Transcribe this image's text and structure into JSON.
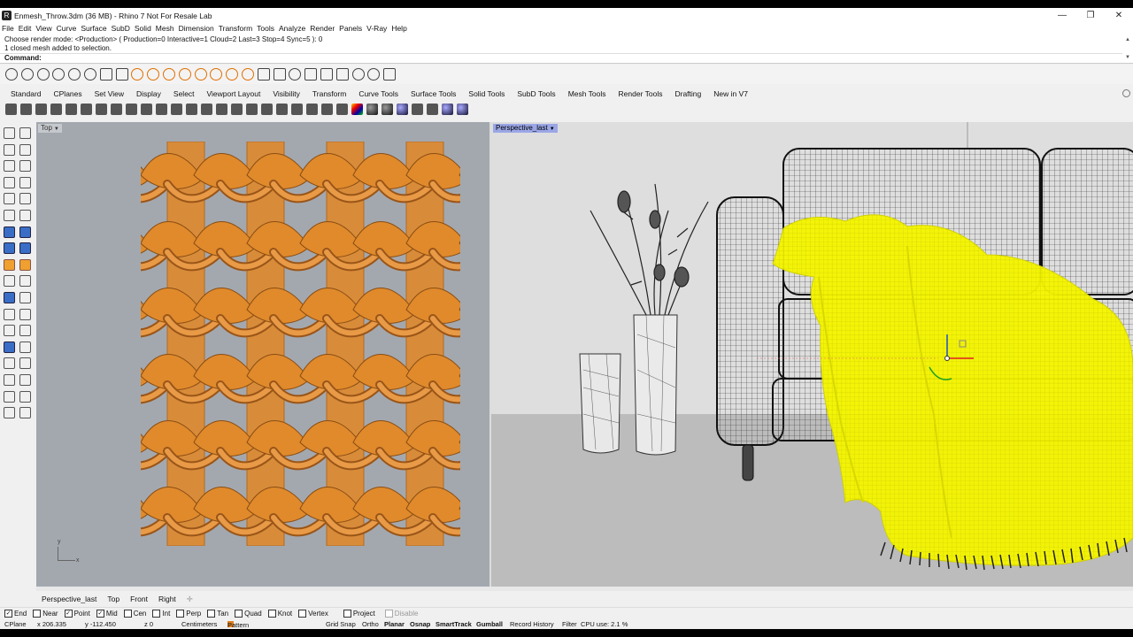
{
  "window": {
    "title": "Enmesh_Throw.3dm (36 MB) - Rhino 7 Not For Resale Lab",
    "app_icon": "rhino-icon"
  },
  "window_controls": {
    "minimize": "—",
    "maximize": "❐",
    "close": "✕"
  },
  "menu": [
    "File",
    "Edit",
    "View",
    "Curve",
    "Surface",
    "SubD",
    "Solid",
    "Mesh",
    "Dimension",
    "Transform",
    "Tools",
    "Analyze",
    "Render",
    "Panels",
    "V-Ray",
    "Help"
  ],
  "command": {
    "history": [
      "Choose render mode: <Production> ( Production=0  Interactive=1  Cloud=2  Last=3  Stop=4  Sync=5 ): 0",
      "1 closed mesh added to selection."
    ],
    "prompt_label": "Command:",
    "prompt_value": ""
  },
  "toolbar_tabs": [
    "Standard",
    "CPlanes",
    "Set View",
    "Display",
    "Select",
    "Viewport Layout",
    "Visibility",
    "Transform",
    "Curve Tools",
    "Surface Tools",
    "Solid Tools",
    "SubD Tools",
    "Mesh Tools",
    "Render Tools",
    "Drafting",
    "New in V7"
  ],
  "viewports": {
    "top": {
      "label": "Top",
      "axis_x": "x",
      "axis_y": "y"
    },
    "perspective": {
      "label": "Perspective_last"
    }
  },
  "viewport_tabs": [
    "Perspective_last",
    "Top",
    "Front",
    "Right"
  ],
  "osnaps": [
    {
      "label": "End",
      "checked": true
    },
    {
      "label": "Near",
      "checked": false
    },
    {
      "label": "Point",
      "checked": true
    },
    {
      "label": "Mid",
      "checked": true
    },
    {
      "label": "Cen",
      "checked": false
    },
    {
      "label": "Int",
      "checked": false
    },
    {
      "label": "Perp",
      "checked": false
    },
    {
      "label": "Tan",
      "checked": false
    },
    {
      "label": "Quad",
      "checked": false
    },
    {
      "label": "Knot",
      "checked": false
    },
    {
      "label": "Vertex",
      "checked": false
    },
    {
      "label": "Project",
      "checked": false
    },
    {
      "label": "Disable",
      "checked": false
    }
  ],
  "status": {
    "cplane": "CPlane",
    "x": "x 206.335",
    "y": "y -112.450",
    "z": "z 0",
    "units": "Centimeters",
    "layer": "Pattern",
    "grid_snap": "Grid Snap",
    "ortho": "Ortho",
    "planar": "Planar",
    "osnap": "Osnap",
    "smarttrack": "SmartTrack",
    "gumball": "Gumball",
    "record_history": "Record History",
    "filter": "Filter",
    "cpu": "CPU use: 2.1 %"
  },
  "colors": {
    "rope": "#e08a2c",
    "selection": "#f5f500",
    "viewport_bg": "#a3a8af",
    "active_label": "#9aa6e6"
  }
}
